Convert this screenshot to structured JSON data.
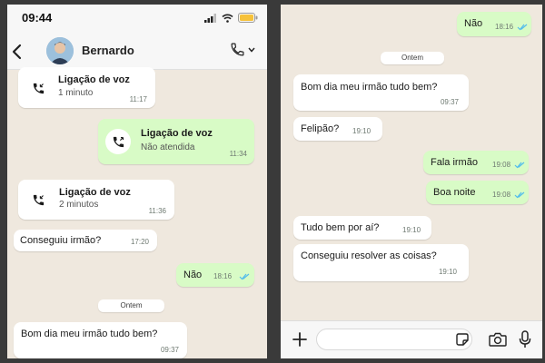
{
  "left_screen": {
    "status_bar": {
      "time": "09:44"
    },
    "header": {
      "contact_name": "Bernardo"
    },
    "messages": [
      {
        "type": "call",
        "direction": "in",
        "title": "Ligação de voz",
        "subtitle": "1 minuto",
        "time": "11:17"
      },
      {
        "type": "call",
        "direction": "out",
        "title": "Ligação de voz",
        "subtitle": "Não atendida",
        "time": "11:34"
      },
      {
        "type": "call",
        "direction": "in",
        "title": "Ligação de voz",
        "subtitle": "2 minutos",
        "time": "11:36"
      },
      {
        "type": "text",
        "direction": "in",
        "text": "Conseguiu irmão?",
        "time": "17:20"
      },
      {
        "type": "text",
        "direction": "out",
        "text": "Não",
        "time": "18:16"
      },
      {
        "type": "date",
        "label": "Ontem"
      },
      {
        "type": "text",
        "direction": "in",
        "text": "Bom dia meu irmão tudo bem?",
        "time": "09:37"
      }
    ]
  },
  "right_screen": {
    "messages": [
      {
        "type": "text",
        "direction": "out",
        "text": "Não",
        "time": "18:16"
      },
      {
        "type": "date",
        "label": "Ontem"
      },
      {
        "type": "text",
        "direction": "in",
        "text": "Bom dia meu irmão tudo bem?",
        "time": "09:37"
      },
      {
        "type": "text",
        "direction": "in",
        "text": "Felipão?",
        "time": "19:10"
      },
      {
        "type": "text",
        "direction": "out",
        "text": "Fala irmão",
        "time": "19:08"
      },
      {
        "type": "text",
        "direction": "out",
        "text": "Boa noite",
        "time": "19:08"
      },
      {
        "type": "text",
        "direction": "in",
        "text": "Tudo bem por aí?",
        "time": "19:10"
      },
      {
        "type": "text",
        "direction": "in",
        "text": "Conseguiu resolver as coisas?",
        "time": "19:10"
      }
    ],
    "input": {
      "value": ""
    }
  },
  "colors": {
    "chat_background": "#efe8de",
    "incoming_bubble": "#ffffff",
    "outgoing_bubble": "#d8fbc6",
    "read_ticks": "#53bdeb",
    "header_background": "#f7f7f7"
  },
  "icons": [
    "back-chevron",
    "voice-call",
    "signal",
    "wifi",
    "battery",
    "plus",
    "sticker",
    "camera",
    "microphone",
    "double-check"
  ]
}
